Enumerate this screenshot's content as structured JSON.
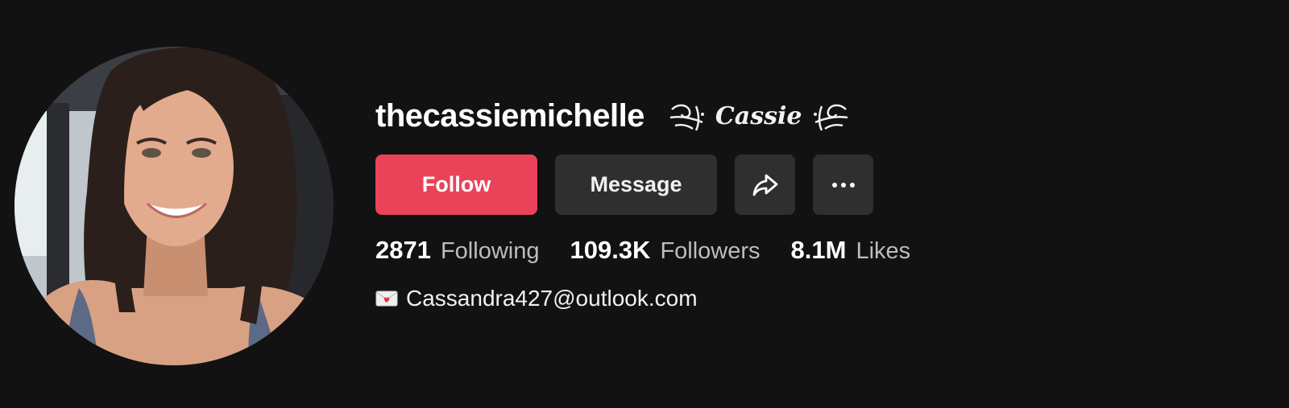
{
  "profile": {
    "username": "thecassiemichelle",
    "nickname": "Cassie",
    "avatar_icon": "profile-photo",
    "buttons": {
      "follow": "Follow",
      "message": "Message",
      "share_icon": "share-arrow-icon",
      "more_icon": "more-dots-icon"
    },
    "stats": {
      "following_count": "2871",
      "following_label": "Following",
      "followers_count": "109.3K",
      "followers_label": "Followers",
      "likes_count": "8.1M",
      "likes_label": "Likes"
    },
    "bio": {
      "icon": "envelope-icon",
      "text": "Cassandra427@outlook.com"
    }
  },
  "colors": {
    "background": "#121212",
    "follow_button": "#ea4359",
    "secondary_button": "#2f2f2f",
    "text_primary": "#ffffff",
    "text_secondary": "#bdbdbd"
  }
}
